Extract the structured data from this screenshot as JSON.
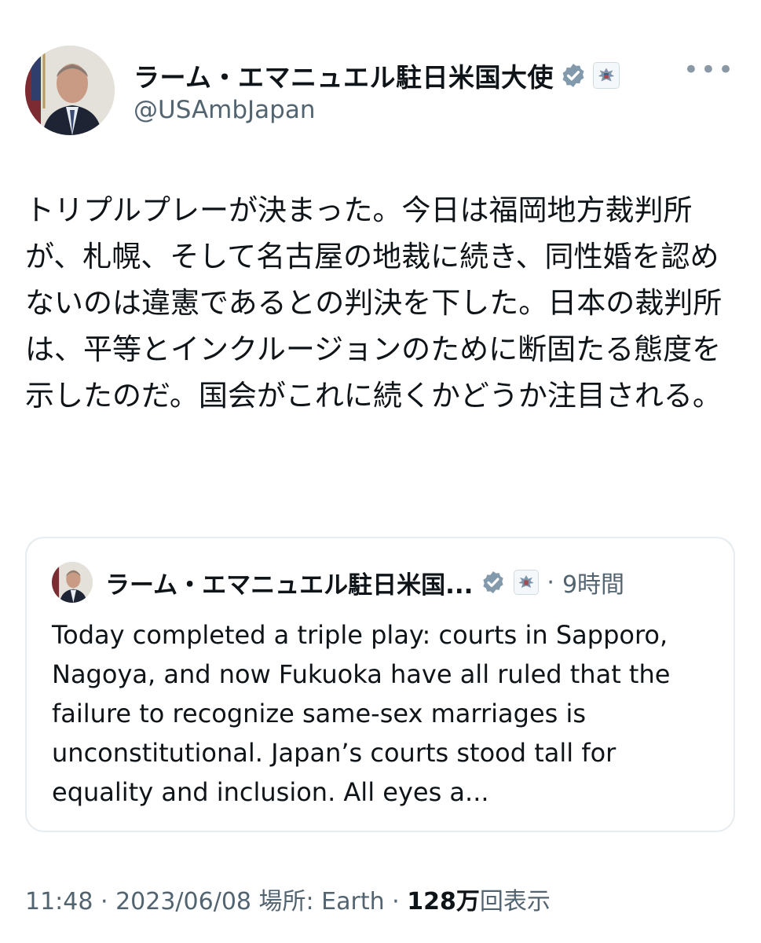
{
  "author": {
    "display_name": "ラーム・エマニュエル駐日米国大使",
    "handle": "@USAmbJapan"
  },
  "icons": {
    "verified": "verified-badge-icon",
    "affiliation": "us-state-department-seal-icon",
    "more": "more-options-icon"
  },
  "tweet": {
    "text": "トリプルプレーが決まった。今日は福岡地方裁判所が、札幌、そして名古屋の地裁に続き、同性婚を認めないのは違憲であるとの判決を下した。日本の裁判所は、平等とインクルージョンのために断固たる態度を示したのだ。国会がこれに続くかどうか注目される。"
  },
  "quoted_tweet": {
    "display_name": "ラーム・エマニュエル駐日米国...",
    "separator": "·",
    "time": "9時間",
    "text": "Today completed a triple play: courts in Sapporo, Nagoya, and now Fukuoka have all ruled that the failure to recognize same-sex marriages is unconstitutional. Japan’s courts stood tall for equality and inclusion. All eyes a..."
  },
  "footer": {
    "time": "11:48",
    "sep1": " · ",
    "date": "2023/06/08",
    "location": " 場所: Earth",
    "sep2": " · ",
    "views_count": "128万",
    "views_label": "回表示"
  },
  "colors": {
    "verified_badge": "#829aab",
    "secondary_text": "#536471",
    "border": "#e6ecf0"
  }
}
